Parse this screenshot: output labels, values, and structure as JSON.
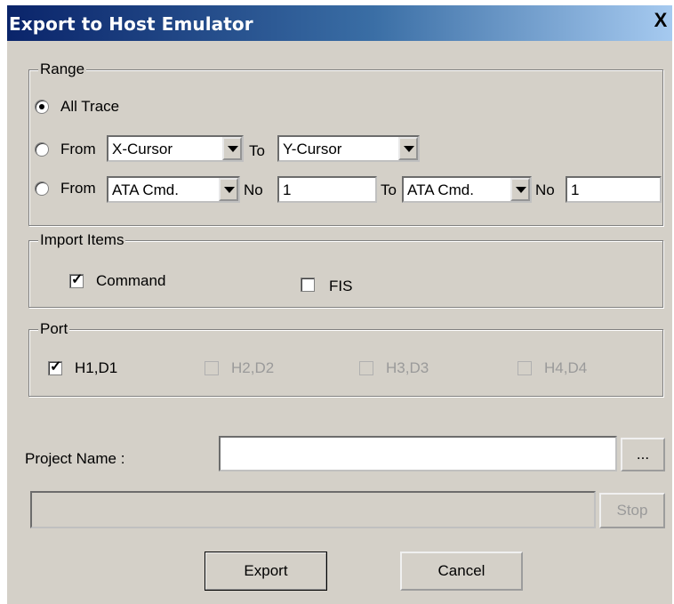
{
  "window": {
    "title": "Export to Host Emulator",
    "close_label": "X"
  },
  "range": {
    "legend": "Range",
    "option_all": {
      "label": "All Trace",
      "selected": true
    },
    "option_cursor": {
      "from_label": "From",
      "from_value": "X-Cursor",
      "to_label": "To",
      "to_value": "Y-Cursor"
    },
    "option_cmd": {
      "from_label": "From",
      "from_value": "ATA Cmd.",
      "no_label": "No",
      "no_value": "1",
      "to_label": "To",
      "to_value": "ATA Cmd.",
      "no2_label": "No",
      "no2_value": "1"
    }
  },
  "import_items": {
    "legend": "Import Items",
    "command": {
      "label": "Command",
      "checked": true
    },
    "fis": {
      "label": "FIS",
      "checked": false
    }
  },
  "port": {
    "legend": "Port",
    "items": [
      {
        "label": "H1,D1",
        "checked": true,
        "enabled": true
      },
      {
        "label": "H2,D2",
        "checked": false,
        "enabled": false
      },
      {
        "label": "H3,D3",
        "checked": false,
        "enabled": false
      },
      {
        "label": "H4,D4",
        "checked": false,
        "enabled": false
      }
    ]
  },
  "project": {
    "label": "Project Name :",
    "value": "",
    "browse_label": "..."
  },
  "progress": {
    "value": 0,
    "stop_label": "Stop"
  },
  "buttons": {
    "export_label": "Export",
    "cancel_label": "Cancel"
  }
}
